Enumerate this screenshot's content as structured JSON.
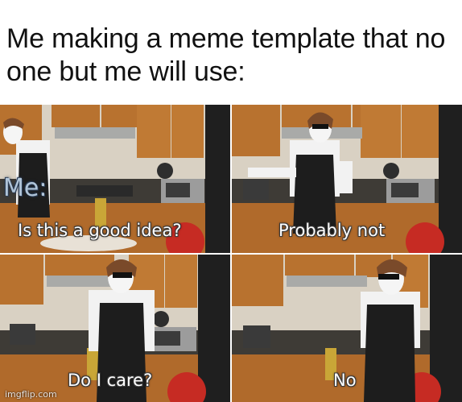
{
  "meme": {
    "caption": "Me making a meme template that no one but me will use:",
    "watermark": "imgflip.com",
    "panels": [
      {
        "label": "Me:",
        "subtitle": "Is this a good idea?"
      },
      {
        "subtitle": "Probably not"
      },
      {
        "subtitle": "Do I care?"
      },
      {
        "subtitle": "No"
      }
    ]
  }
}
